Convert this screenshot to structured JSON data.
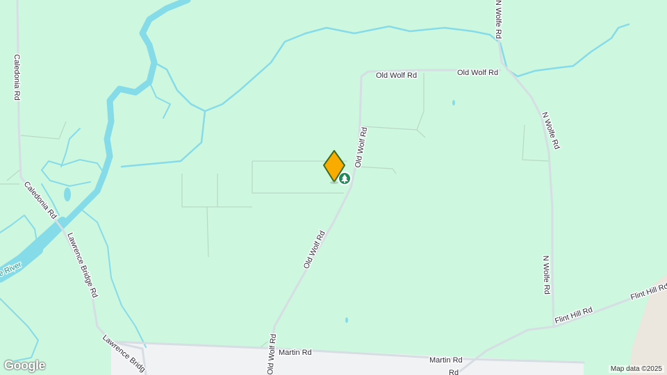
{
  "roads": {
    "old_wolf_rd_top_1": "Old Wolf Rd",
    "old_wolf_rd_top_2": "Old Wolf Rd",
    "old_wolf_rd_vertical": "Old Wolf Rd",
    "old_wolf_rd_lower": "Old Wolf Rd",
    "old_wolf_rd_bottom": "Old Wolf Rd",
    "n_wolfe_rd_top": "N Wolfe Rd",
    "n_wolfe_rd_mid": "N Wolfe Rd",
    "n_wolfe_rd_lower": "N Wolfe Rd",
    "caledonia_rd_top": "Caledonia Rd",
    "caledonia_rd_lower": "Caledonia Rd",
    "lawrence_bridge_rd_1": "Lawrence Bridge Rd",
    "lawrence_bridge_rd_2": "Lawrence Bridg",
    "martin_rd_1": "Martin Rd",
    "martin_rd_2": "Martin Rd",
    "flint_hill_rd_1": "Flint Hill Rd",
    "flint_hill_rd_2": "Flint Hill Rd",
    "partial_rd": "Rd"
  },
  "river_label": "e River",
  "attribution": "Map data ©2025",
  "logo_text": "Google",
  "colors": {
    "land": "#cdf7df",
    "water": "#86dbe8",
    "road": "#d6dde3",
    "urban": "#f1f2f4",
    "marker": "#f9ab00",
    "park_pin": "#1e8a5a"
  },
  "marker_icon": "diamond-marker-icon",
  "poi_icon": "tree-pin-icon"
}
